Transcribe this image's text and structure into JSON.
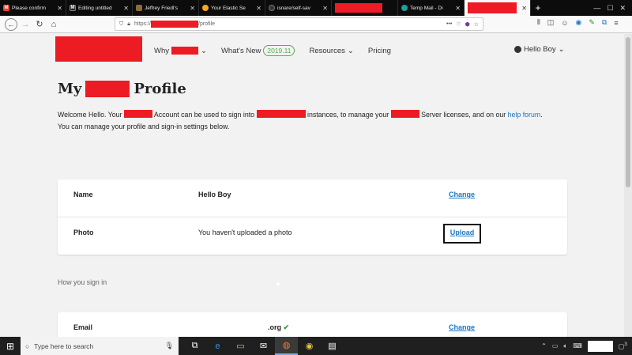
{
  "tabs": [
    {
      "title": "Please confirm",
      "favicon_color": "#ea4335",
      "favicon_glyph": "M",
      "active": false
    },
    {
      "title": "Editing untitled",
      "favicon_color": "#222222",
      "favicon_glyph": "M",
      "active": false
    },
    {
      "title": "Jeffrey Friedl's",
      "favicon_color": "#8a6d3b",
      "favicon_glyph": "",
      "active": false
    },
    {
      "title": "Your Elastic Se",
      "favicon_color": "#f5a623",
      "favicon_glyph": "",
      "active": false
    },
    {
      "title": "isnare/self-sav",
      "favicon_color": "#333333",
      "favicon_glyph": "",
      "active": false
    },
    {
      "title": "",
      "favicon_color": "",
      "favicon_glyph": "",
      "active": false,
      "redacted": true
    },
    {
      "title": "Temp Mail - Di",
      "favicon_color": "#18a39a",
      "favicon_glyph": "",
      "active": false
    },
    {
      "title": "",
      "favicon_color": "",
      "favicon_glyph": "",
      "active": true,
      "redacted": true
    }
  ],
  "toolbar": {
    "url_prefix": "https://",
    "url_suffix": "/profile",
    "new_tab": "+",
    "menu_dots": "•••"
  },
  "site": {
    "menu": {
      "why_prefix": "Why",
      "whats_new": "What's New",
      "version_badge": "2019.11",
      "resources": "Resources",
      "pricing": "Pricing"
    },
    "user_name": "Hello Boy"
  },
  "profile": {
    "heading_left": "My",
    "heading_right": "Profile",
    "intro_1": "Welcome Hello. Your",
    "intro_2": "Account can be used to sign into",
    "intro_3": "instances, to manage your",
    "intro_4": "Server licenses, and on our",
    "help_link": "help forum",
    "intro_5": ".",
    "intro_6": "You can manage your profile and sign-in settings below.",
    "rows": [
      {
        "label": "Name",
        "value": "Hello Boy",
        "action": "Change"
      },
      {
        "label": "Photo",
        "value": "You haven't uploaded a photo",
        "action": "Upload"
      }
    ],
    "signin_section": "How you sign in",
    "email_row": {
      "label": "Email",
      "value": ".org",
      "action": "Change"
    }
  },
  "taskbar": {
    "search_placeholder": "Type here to search",
    "notification_count": "3"
  },
  "colors": {
    "link": "#1a76c4",
    "badge": "#52b04a",
    "redaction": "#ed1c24"
  }
}
